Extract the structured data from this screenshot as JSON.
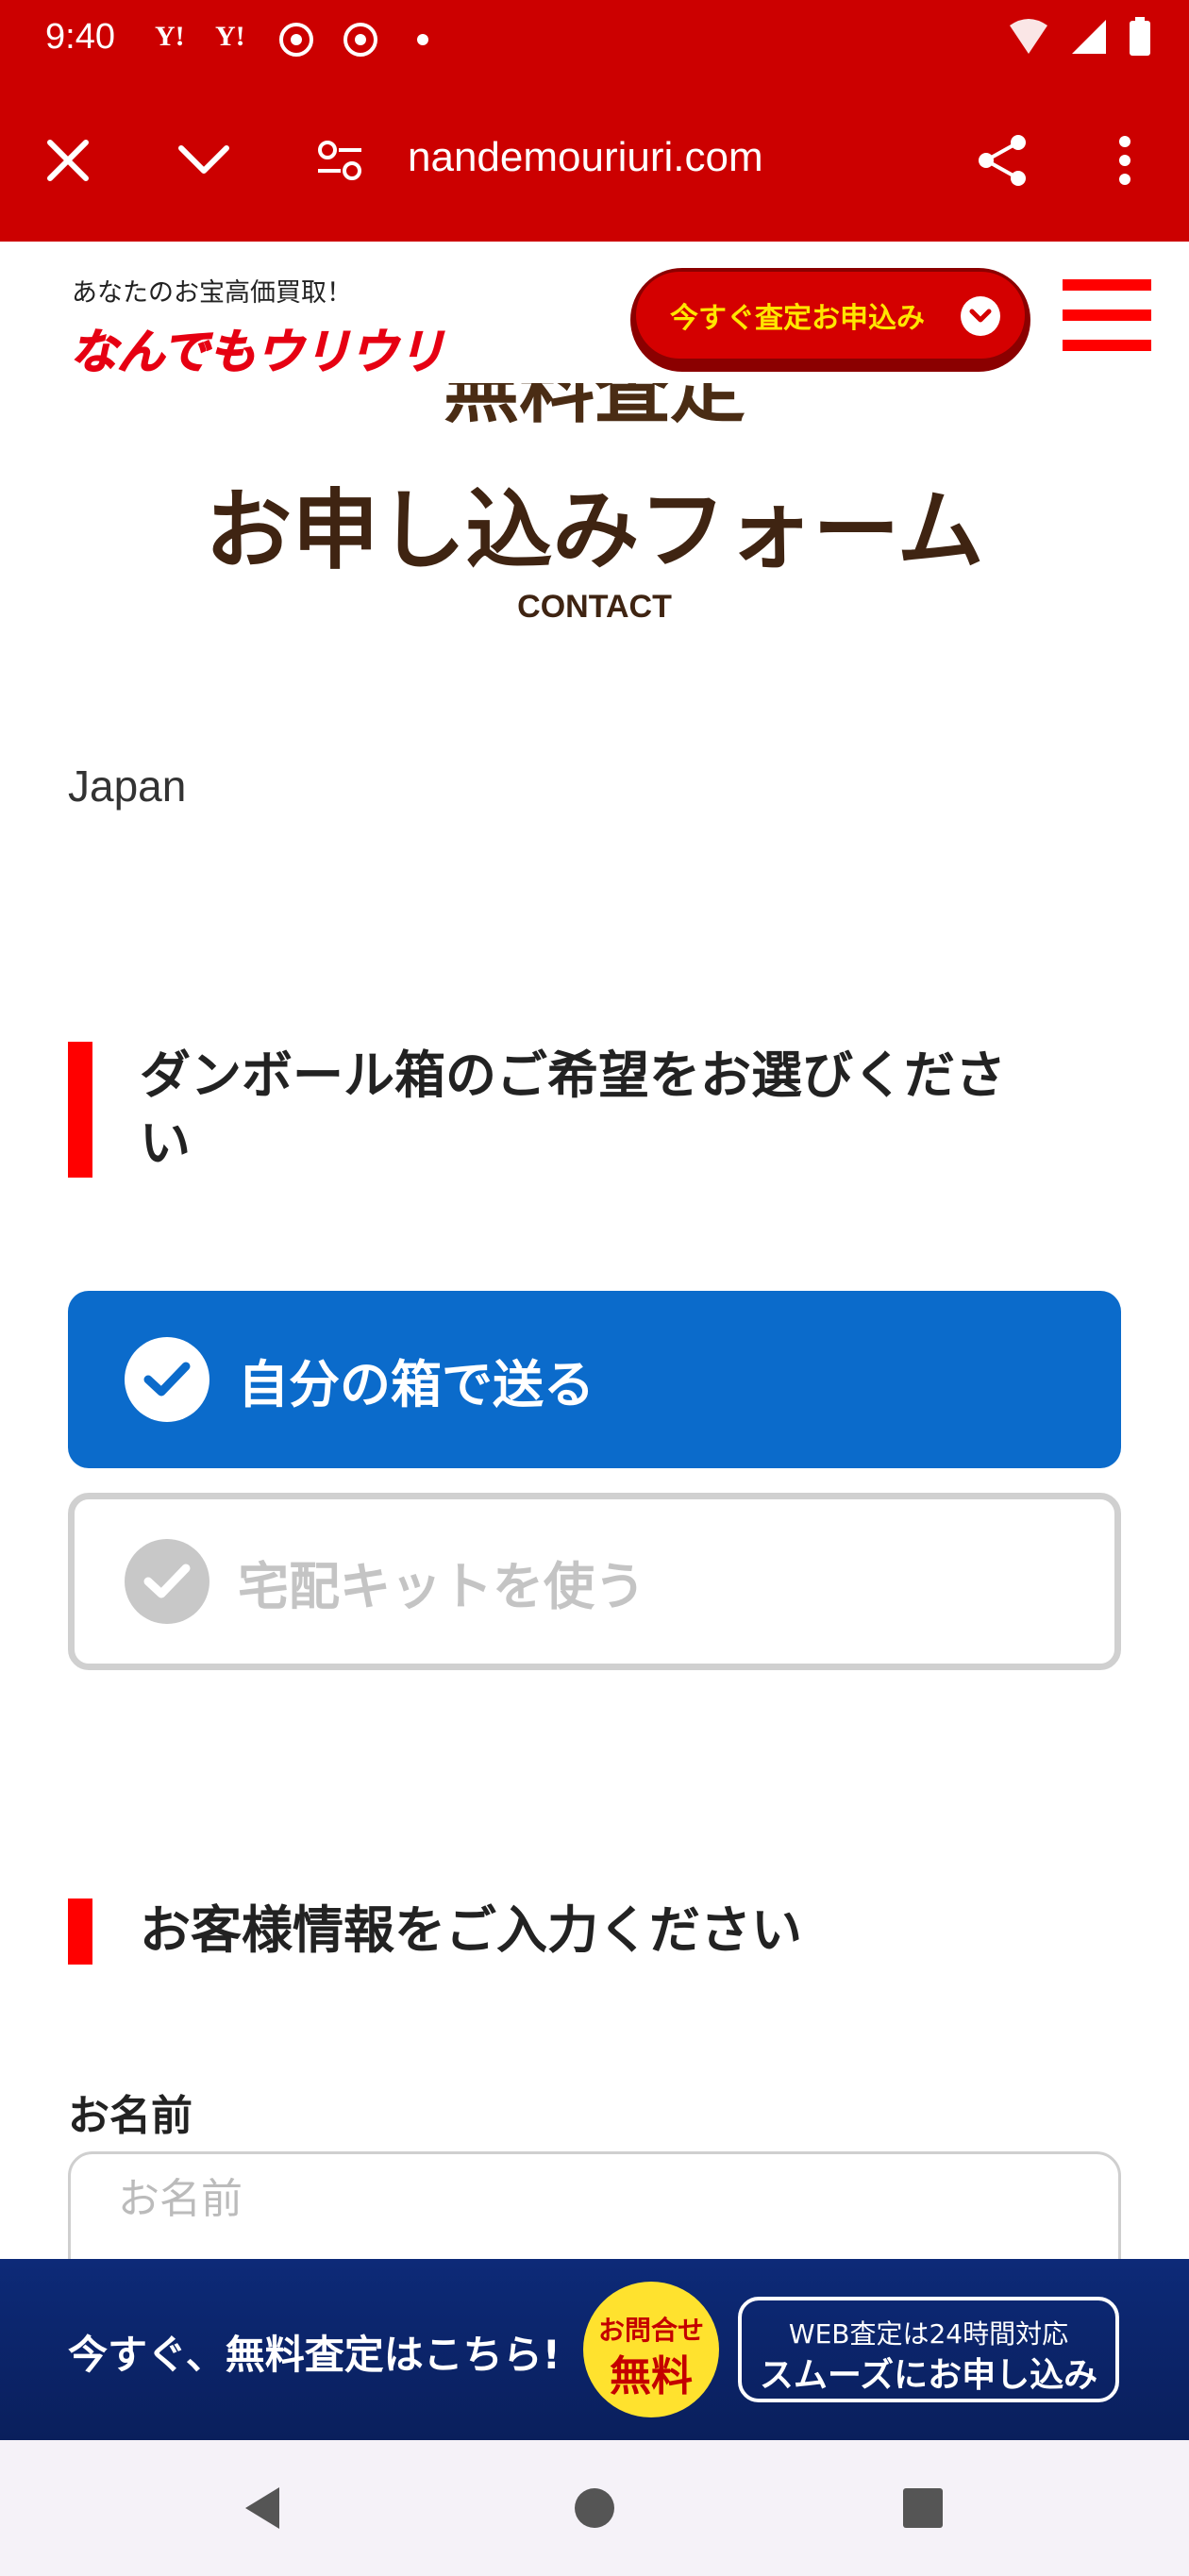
{
  "status_bar": {
    "time": "9:40",
    "notifications": [
      "Y!",
      "Y!"
    ],
    "icons": [
      "yahoo-icon",
      "yahoo-icon",
      "chrome-icon",
      "chrome-icon",
      "dot-icon",
      "wifi-icon",
      "signal-icon",
      "battery-icon"
    ]
  },
  "browser": {
    "url": "nandemouriuri.com",
    "close_icon": "close-icon",
    "expand_icon": "chevron-down-icon",
    "site_settings_icon": "tune-icon",
    "share_icon": "share-icon",
    "menu_icon": "more-vert-icon",
    "theme_color": "#cc0000"
  },
  "header": {
    "tagline": "あなたのお宝高価買取！",
    "logo_text": "なんでもウリウリ",
    "apply_button_label": "今すぐ査定お申込み",
    "menu_icon": "hamburger-icon"
  },
  "form_heading": {
    "top": "無料査定",
    "main": "お申し込みフォーム",
    "sub": "CONTACT"
  },
  "location_text": "Japan",
  "box_section": {
    "title_line1": "ダンボール箱のご希望をお選びくださ",
    "title_line2": "い",
    "options": [
      {
        "label": "自分の箱で送る",
        "selected": true
      },
      {
        "label": "宅配キットを使う",
        "selected": false
      }
    ]
  },
  "customer_section": {
    "title": "お客様情報をご入力ください",
    "name_label": "お名前",
    "name_placeholder": "お名前",
    "name_value": ""
  },
  "cta": {
    "text": "今すぐ、無料査定はこちら!",
    "badge_top": "お問合せ",
    "badge_bottom": "無料",
    "button_small": "WEB査定は24時間対応",
    "button_big": "スムーズにお申し込み"
  },
  "colors": {
    "brand_red": "#cc0000",
    "accent_red": "#ff0000",
    "heading_brown": "#3f2412",
    "selected_blue": "#0b6bcb",
    "cta_navy": "#0d2a78",
    "badge_yellow": "#ffe22e"
  }
}
